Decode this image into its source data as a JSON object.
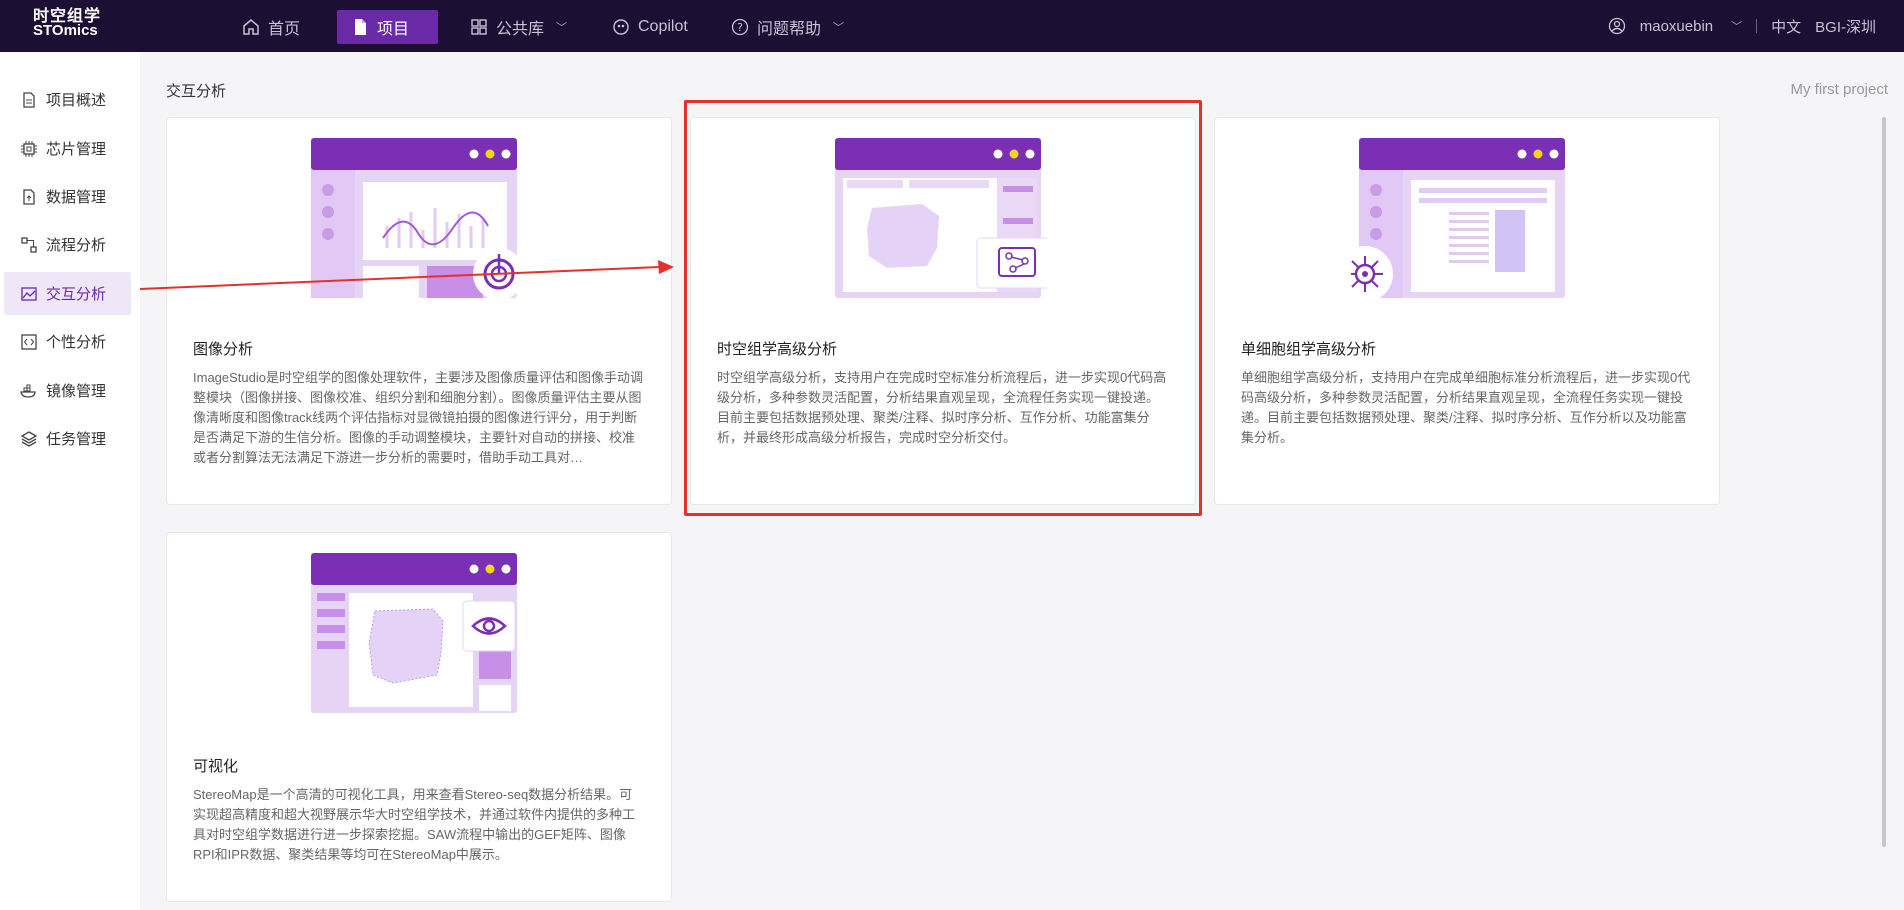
{
  "header": {
    "logo_line1": "时空组学",
    "logo_line2": "STOmics",
    "nav": [
      {
        "label": "首页",
        "icon": "home-icon"
      },
      {
        "label": "项目",
        "icon": "document-icon"
      },
      {
        "label": "公共库",
        "icon": "grid-icon"
      },
      {
        "label": "Copilot",
        "icon": "copilot-icon"
      },
      {
        "label": "问题帮助",
        "icon": "help-icon"
      }
    ],
    "user": "maoxuebin",
    "language": "中文",
    "region": "BGI-深圳"
  },
  "sidebar": {
    "items": [
      {
        "label": "项目概述",
        "icon": "document-icon"
      },
      {
        "label": "芯片管理",
        "icon": "chip-icon"
      },
      {
        "label": "数据管理",
        "icon": "file-upload-icon"
      },
      {
        "label": "流程分析",
        "icon": "flow-icon"
      },
      {
        "label": "交互分析",
        "icon": "image-chart-icon"
      },
      {
        "label": "个性分析",
        "icon": "code-icon"
      },
      {
        "label": "镜像管理",
        "icon": "docker-icon"
      },
      {
        "label": "任务管理",
        "icon": "layers-icon"
      }
    ]
  },
  "main": {
    "title": "交互分析",
    "project_name": "My first project",
    "cards": [
      {
        "title": "图像分析",
        "description": "ImageStudio是时空组学的图像处理软件，主要涉及图像质量评估和图像手动调整模块（图像拼接、图像校准、组织分割和细胞分割）。图像质量评估主要从图像清晰度和图像track线两个评估指标对显微镜拍摄的图像进行评分，用于判断是否满足下游的生信分析。图像的手动调整模块，主要针对自动的拼接、校准或者分割算法无法满足下游进一步分析的需要时，借助手动工具对…"
      },
      {
        "title": "时空组学高级分析",
        "description": "时空组学高级分析，支持用户在完成时空标准分析流程后，进一步实现0代码高级分析，多种参数灵活配置，分析结果直观呈现，全流程任务实现一键投递。目前主要包括数据预处理、聚类/注释、拟时序分析、互作分析、功能富集分析，并最终形成高级分析报告，完成时空分析交付。"
      },
      {
        "title": "单细胞组学高级分析",
        "description": "单细胞组学高级分析，支持用户在完成单细胞标准分析流程后，进一步实现0代码高级分析，多种参数灵活配置，分析结果直观呈现，全流程任务实现一键投递。目前主要包括数据预处理、聚类/注释、拟时序分析、互作分析以及功能富集分析。"
      },
      {
        "title": "可视化",
        "description": "StereoMap是一个高清的可视化工具，用来查看Stereo-seq数据分析结果。可实现超高精度和超大视野展示华大时空组学技术，并通过软件内提供的多种工具对时空组学数据进行进一步探索挖掘。SAW流程中输出的GEF矩阵、图像RPI和IPR数据、聚类结果等均可在StereoMap中展示。"
      }
    ]
  },
  "colors": {
    "topbar": "#1d0e33",
    "accent": "#6a2aa8",
    "highlight": "#e5312d"
  }
}
